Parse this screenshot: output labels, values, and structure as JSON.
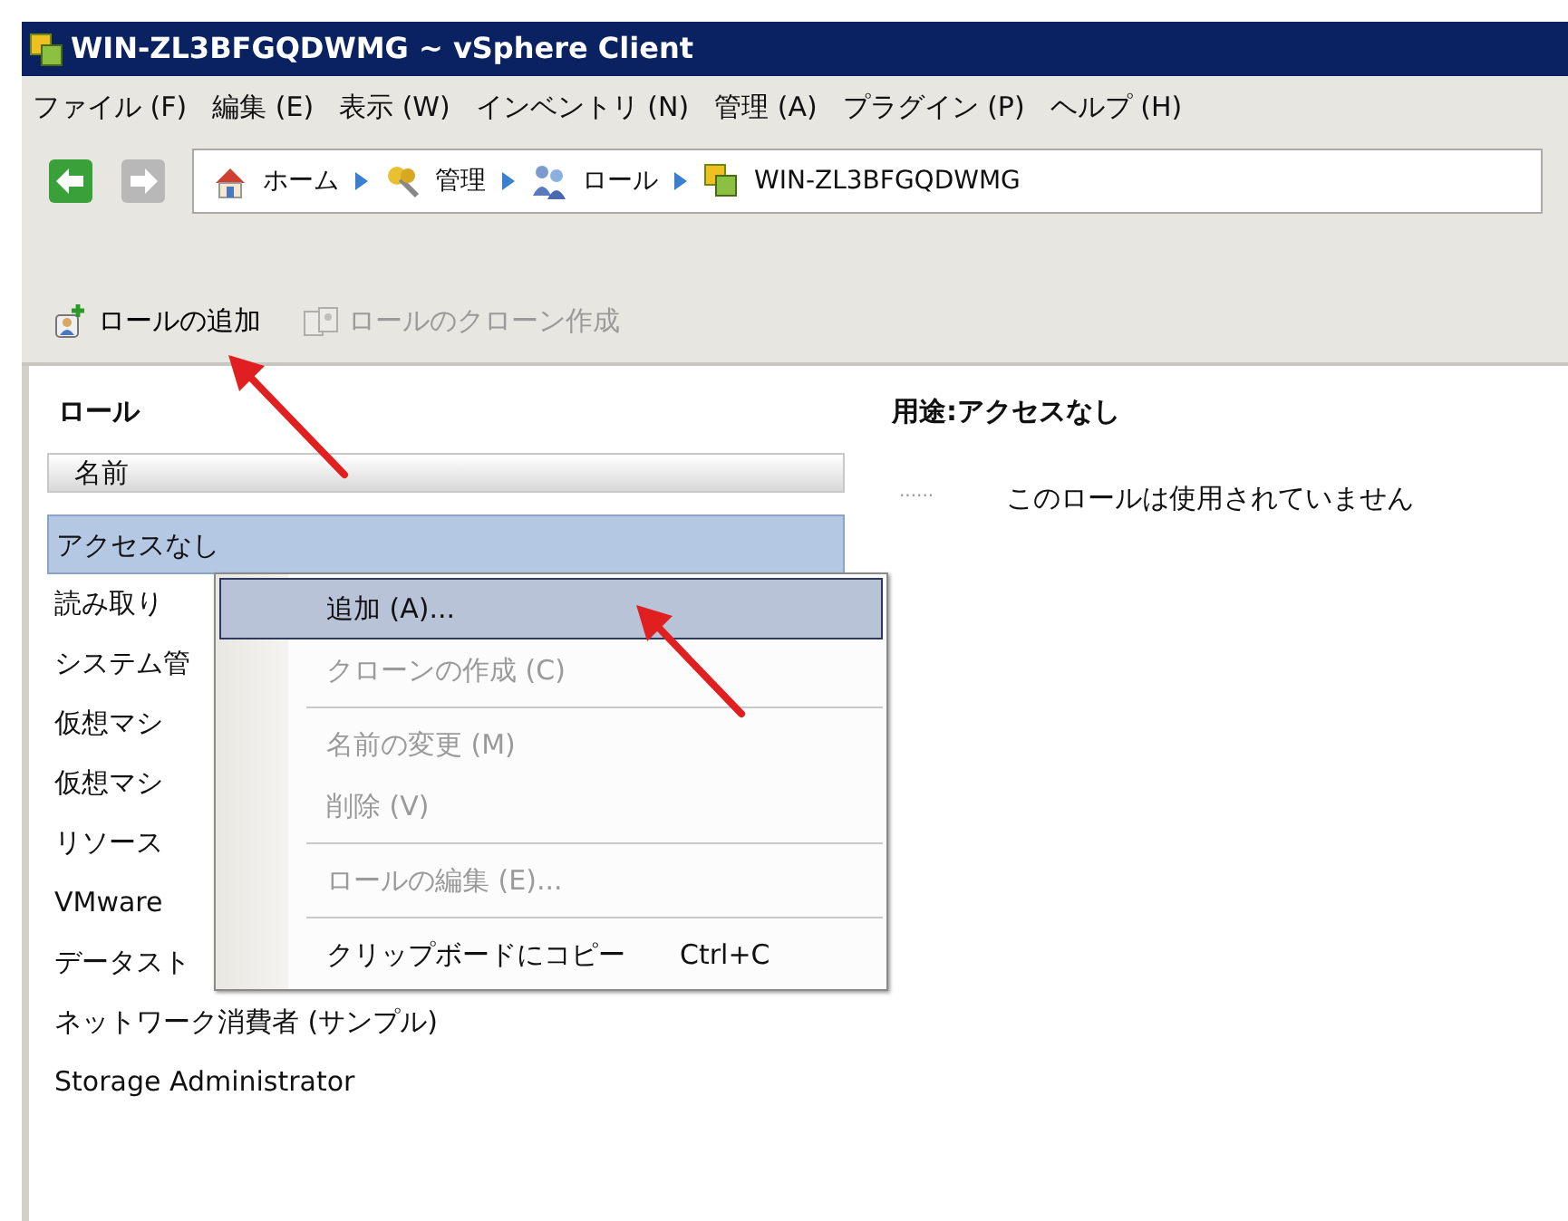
{
  "window": {
    "title": "WIN-ZL3BFGQDWMG ~ vSphere Client"
  },
  "menu_bar": [
    "ファイル (F)",
    "編集 (E)",
    "表示 (W)",
    "インベントリ (N)",
    "管理 (A)",
    "プラグイン (P)",
    "ヘルプ (H)"
  ],
  "navigation": {
    "back": {
      "disabled": false
    },
    "forward": {
      "disabled": true
    },
    "breadcrumb": [
      {
        "kind": "home",
        "label": "ホーム"
      },
      {
        "kind": "admin",
        "label": "管理"
      },
      {
        "kind": "roles",
        "label": "ロール"
      },
      {
        "kind": "host",
        "label": "WIN-ZL3BFGQDWMG"
      }
    ]
  },
  "toolbar": [
    {
      "kind": "add",
      "label": "ロールの追加",
      "disabled": false
    },
    {
      "kind": "clone",
      "label": "ロールのクローン作成",
      "disabled": true
    }
  ],
  "roles_panel": {
    "title": "ロール",
    "column": "名前",
    "rows": [
      {
        "name": "アクセスなし",
        "selected": true
      },
      {
        "name": "読み取り",
        "selected": false
      },
      {
        "name": "システム管",
        "selected": false
      },
      {
        "name": "仮想マシ",
        "selected": false
      },
      {
        "name": "仮想マシ",
        "selected": false
      },
      {
        "name": "リソース",
        "selected": false
      },
      {
        "name": "VMware",
        "selected": false
      },
      {
        "name": "データスト",
        "selected": false
      },
      {
        "name": "ネットワーク消費者 (サンプル)",
        "selected": false
      },
      {
        "name": "Storage Administrator",
        "selected": false
      }
    ]
  },
  "usage_panel": {
    "title": "用途:アクセスなし",
    "entries": [
      {
        "marker": "......",
        "text": "このロールは使用されていません"
      }
    ]
  },
  "context_menu": {
    "items": [
      {
        "kind": "item",
        "label": "追加 (A)...",
        "selected": true,
        "disabled": false
      },
      {
        "kind": "item",
        "label": "クローンの作成 (C)",
        "selected": false,
        "disabled": true
      },
      {
        "kind": "separator"
      },
      {
        "kind": "item",
        "label": "名前の変更 (M)",
        "selected": false,
        "disabled": true
      },
      {
        "kind": "item",
        "label": "削除 (V)",
        "selected": false,
        "disabled": true
      },
      {
        "kind": "separator"
      },
      {
        "kind": "item",
        "label": "ロールの編集 (E)...",
        "selected": false,
        "disabled": true
      },
      {
        "kind": "separator"
      },
      {
        "kind": "item",
        "label": "クリップボードにコピー",
        "shortcut": "Ctrl+C",
        "selected": false,
        "disabled": false
      }
    ]
  }
}
